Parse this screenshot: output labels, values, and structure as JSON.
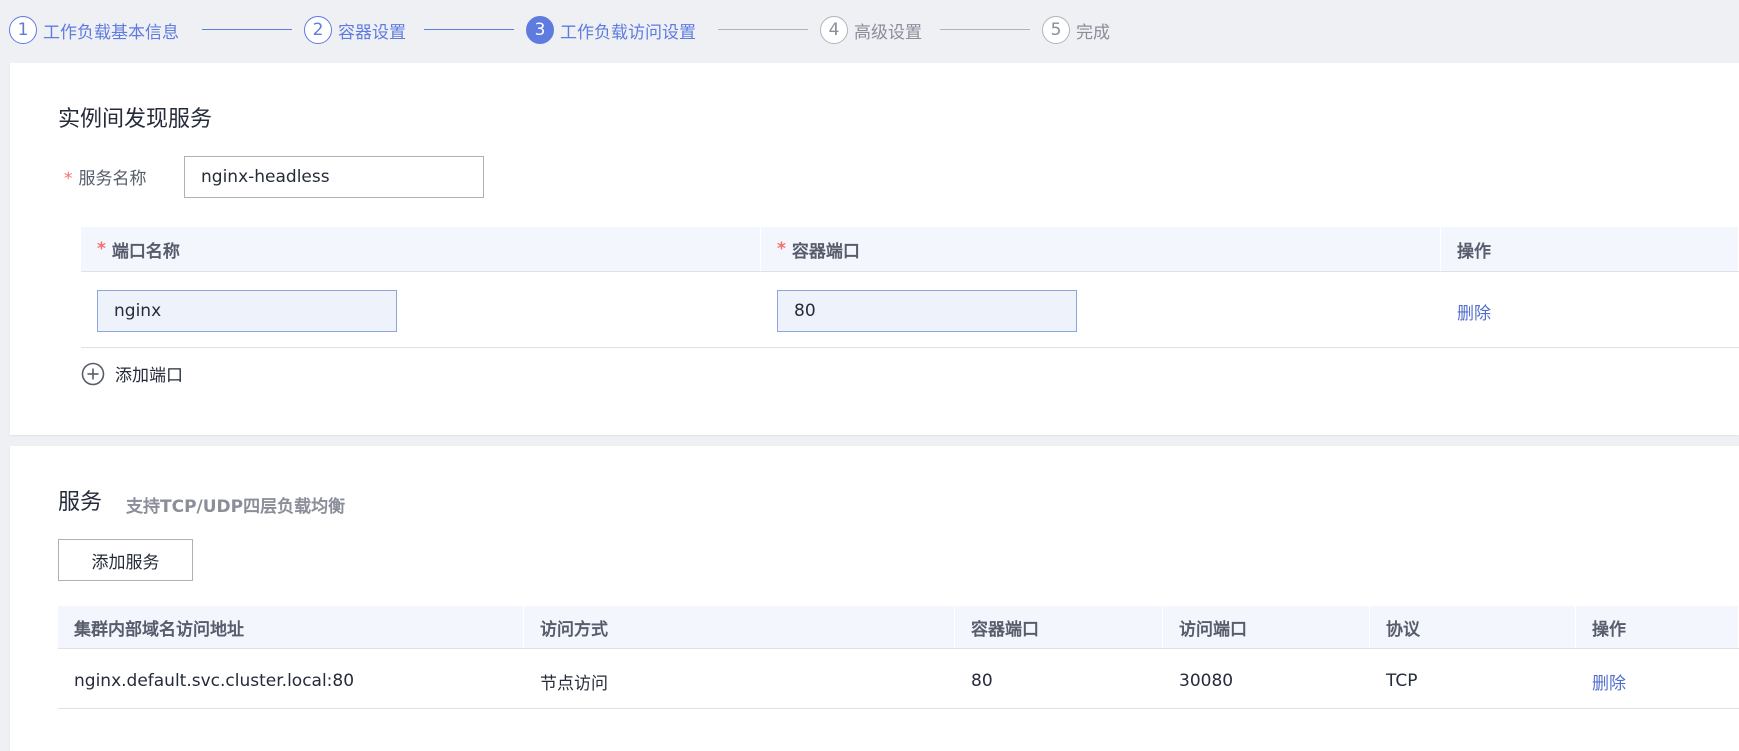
{
  "steps": [
    {
      "num": "1",
      "label": "工作负载基本信息",
      "state": "done"
    },
    {
      "num": "2",
      "label": "容器设置",
      "state": "done"
    },
    {
      "num": "3",
      "label": "工作负载访问设置",
      "state": "active"
    },
    {
      "num": "4",
      "label": "高级设置",
      "state": "todo"
    },
    {
      "num": "5",
      "label": "完成",
      "state": "todo"
    }
  ],
  "discovery": {
    "title": "实例间发现服务",
    "service_name_label": "服务名称",
    "service_name_value": "nginx-headless",
    "required_mark": "*",
    "table": {
      "headers": [
        "端口名称",
        "容器端口",
        "操作"
      ],
      "rows": [
        {
          "port_name": "nginx",
          "container_port": "80",
          "action": "删除"
        }
      ]
    },
    "add_port_label": "添加端口"
  },
  "service": {
    "title": "服务",
    "hint": "支持TCP/UDP四层负载均衡",
    "add_button": "添加服务",
    "table": {
      "headers": [
        "集群内部域名访问地址",
        "访问方式",
        "容器端口",
        "访问端口",
        "协议",
        "操作"
      ],
      "rows": [
        {
          "address": "nginx.default.svc.cluster.local:80",
          "access_type": "节点访问",
          "container_port": "80",
          "access_port": "30080",
          "protocol": "TCP",
          "action": "删除"
        }
      ]
    }
  },
  "colors": {
    "accent": "#5e7ce0",
    "link": "#526ecc",
    "required": "#f66f6a",
    "table_header_bg": "#f3f6fc"
  }
}
